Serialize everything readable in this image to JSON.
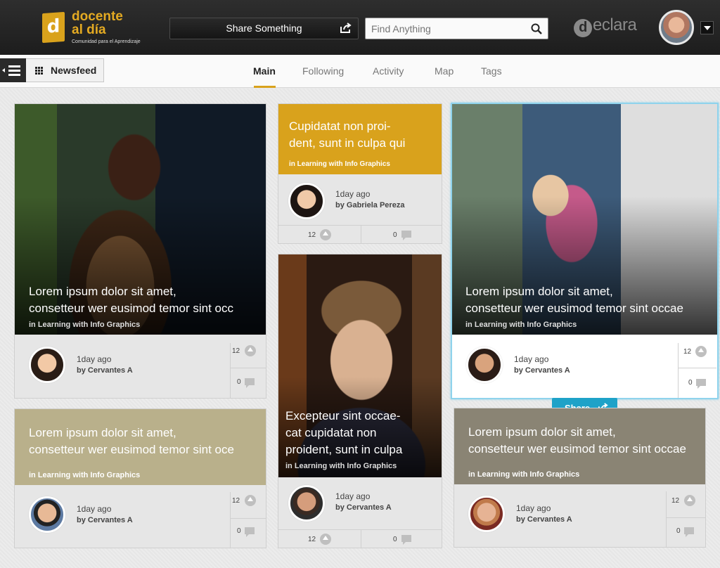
{
  "header": {
    "logo_title_line1": "docente",
    "logo_title_line2": "al día",
    "logo_tagline": "Comunidad para el Aprendizaje",
    "share_label": "Share Something",
    "search_placeholder": "Find Anything",
    "brand": "eclara",
    "brand_letter": "d"
  },
  "nav": {
    "newsfeed_label": "Newsfeed",
    "tabs": [
      "Main",
      "Following",
      "Activity",
      "Map",
      "Tags"
    ],
    "active_tab": "Main",
    "accent": "#d9a21c"
  },
  "cards": [
    {
      "title_line1": "Lorem ipsum dolor sit amet,",
      "title_line2": "consetteur wer eusimod temor sint occ",
      "topic": "in Learning with Info Graphics",
      "time": "1day ago",
      "author": "by Cervantes A",
      "likes": "12",
      "comments": "0"
    },
    {
      "title_line1": "Lorem ipsum dolor sit amet,",
      "title_line2": "consetteur wer eusimod temor sint oce",
      "topic": "in Learning with Info Graphics",
      "time": "1day ago",
      "author": "by Cervantes A",
      "likes": "12",
      "comments": "0",
      "color": "#b9b08b"
    },
    {
      "title_line1": "Cupidatat non proi-",
      "title_line2": "dent, sunt in culpa qui",
      "topic": "in Learning with Info Graphics",
      "time": "1day ago",
      "author": "by Gabriela Pereza",
      "likes": "12",
      "comments": "0",
      "color": "#d9a21c"
    },
    {
      "title_line1": "Excepteur sint occae-",
      "title_line2": "cat cupidatat non",
      "title_line3": "proident, sunt in culpa",
      "topic": "in Learning with Info Graphics",
      "time": "1day ago",
      "author": "by Cervantes A",
      "likes": "12",
      "comments": "0"
    },
    {
      "title_line1": "Lorem ipsum dolor sit amet,",
      "title_line2": "consetteur wer eusimod temor sint occae",
      "topic": "in Learning with Info Graphics",
      "time": "1day ago",
      "author": "by Cervantes A",
      "likes": "12",
      "comments": "0",
      "accent": "#8fd3ec"
    },
    {
      "title_line1": "Lorem ipsum dolor sit amet,",
      "title_line2": "consetteur wer eusimod temor sint occae",
      "topic": "in Learning with Info Graphics",
      "time": "1day ago",
      "author": "by Cervantes A",
      "likes": "12",
      "comments": "0",
      "color": "#8a8474"
    }
  ],
  "share_popup": {
    "label": "Share",
    "color": "#1ea2c8"
  }
}
